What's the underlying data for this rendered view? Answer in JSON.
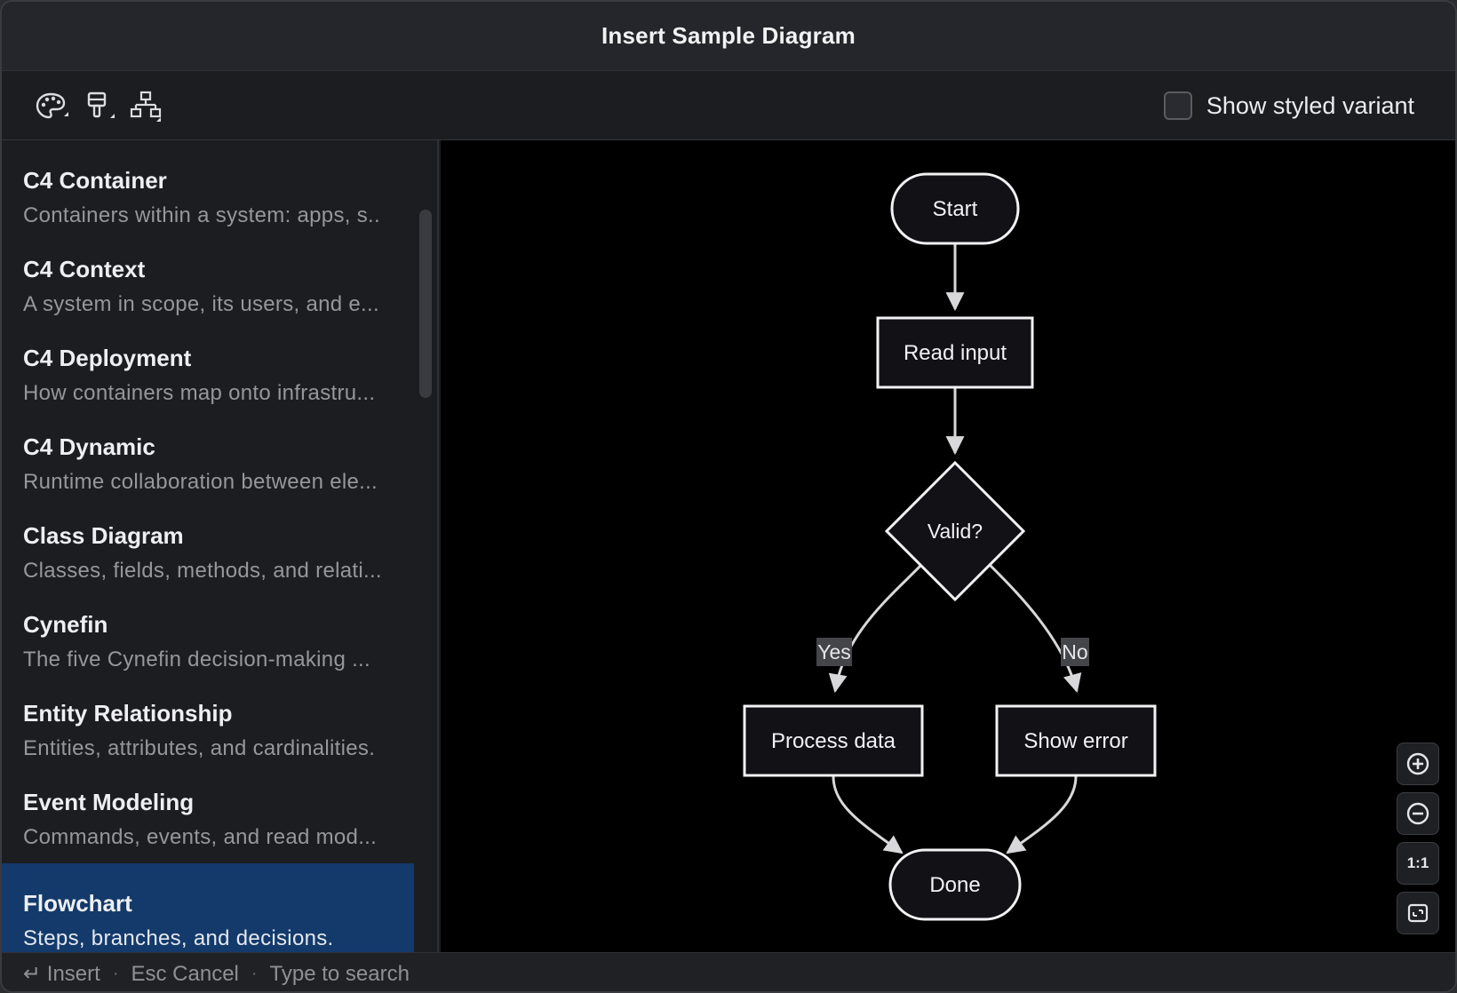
{
  "window": {
    "title": "Insert Sample Diagram"
  },
  "toolbar": {
    "icons": [
      "palette-icon",
      "brush-icon",
      "hierarchy-icon"
    ],
    "styled_variant_label": "Show styled variant",
    "styled_variant_checked": false
  },
  "sidebar": {
    "items": [
      {
        "title": "C4 Container",
        "desc": "Containers within a system: apps, s.."
      },
      {
        "title": "C4 Context",
        "desc": "A system in scope, its users, and e..."
      },
      {
        "title": "C4 Deployment",
        "desc": "How containers map onto infrastru..."
      },
      {
        "title": "C4 Dynamic",
        "desc": "Runtime collaboration between ele..."
      },
      {
        "title": "Class Diagram",
        "desc": "Classes, fields, methods, and relati..."
      },
      {
        "title": "Cynefin",
        "desc": "The five Cynefin decision-making ..."
      },
      {
        "title": "Entity Relationship",
        "desc": "Entities, attributes, and cardinalities."
      },
      {
        "title": "Event Modeling",
        "desc": "Commands, events, and read mod..."
      },
      {
        "title": "Flowchart",
        "desc": "Steps, branches, and decisions."
      }
    ],
    "selected_index": 8
  },
  "diagram": {
    "nodes": {
      "start": "Start",
      "read": "Read input",
      "valid": "Valid?",
      "process": "Process data",
      "error": "Show error",
      "done": "Done"
    },
    "edge_labels": {
      "yes": "Yes",
      "no": "No"
    }
  },
  "zoom": {
    "reset_label": "1:1"
  },
  "footer": {
    "insert": "↵ Insert",
    "cancel": "Esc Cancel",
    "search": "Type to search",
    "separator": "·"
  }
}
